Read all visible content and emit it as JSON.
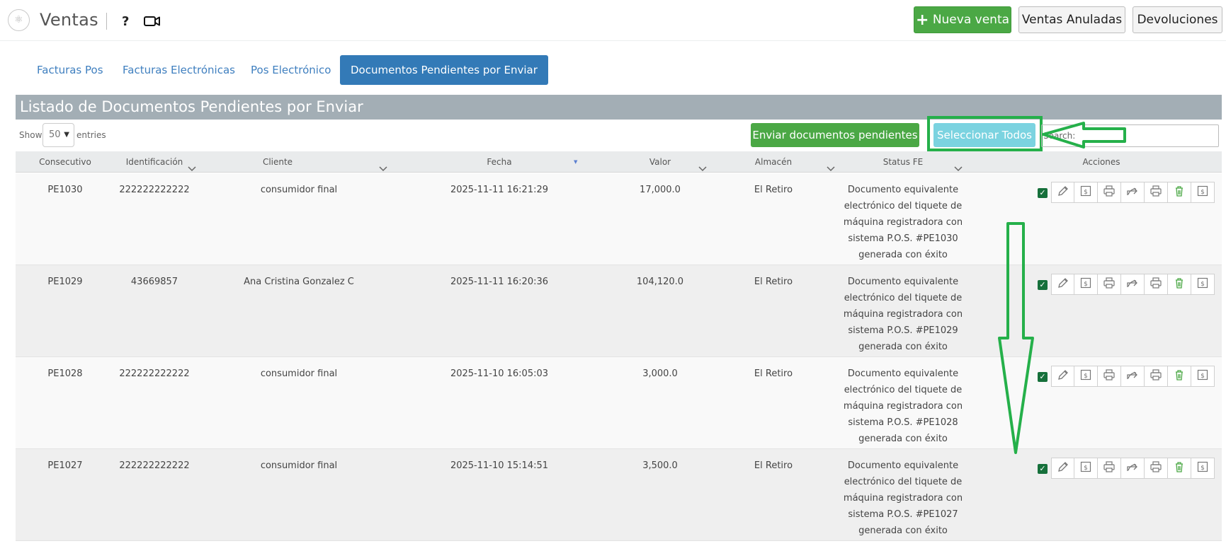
{
  "header": {
    "title": "Ventas",
    "help": "?",
    "buttons": {
      "new_sale": "Nueva venta",
      "voided": "Ventas Anuladas",
      "returns": "Devoluciones"
    }
  },
  "tabs": [
    {
      "label": "Facturas Pos"
    },
    {
      "label": "Facturas Electrónicas"
    },
    {
      "label": "Pos Electrónico"
    },
    {
      "label": "Documentos Pendientes por Enviar"
    }
  ],
  "panel": {
    "title": "Listado de Documentos Pendientes por Enviar",
    "show": "Show",
    "entries": "entries",
    "page_size": "50",
    "send_button": "Enviar documentos pendientes",
    "select_all_button": "Seleccionar Todos",
    "search_label": "Search:"
  },
  "table": {
    "columns": [
      "Consecutivo",
      "Identificación",
      "Cliente",
      "Fecha",
      "Valor",
      "Almacén",
      "Status FE",
      "Acciones"
    ],
    "rows": [
      {
        "consecutivo": "PE1030",
        "identificacion": "222222222222",
        "cliente": "consumidor final",
        "fecha": "2025-11-11 16:21:29",
        "valor": "17,000.0",
        "almacen": "El Retiro",
        "status": [
          "Documento equivalente",
          "electrónico del tiquete de",
          "máquina registradora con",
          "sistema P.O.S. #PE1030",
          "generada con éxito"
        ]
      },
      {
        "consecutivo": "PE1029",
        "identificacion": "43669857",
        "cliente": "Ana Cristina Gonzalez C",
        "fecha": "2025-11-11 16:20:36",
        "valor": "104,120.0",
        "almacen": "El Retiro",
        "status": [
          "Documento equivalente",
          "electrónico del tiquete de",
          "máquina registradora con",
          "sistema P.O.S. #PE1029",
          "generada con éxito"
        ]
      },
      {
        "consecutivo": "PE1028",
        "identificacion": "222222222222",
        "cliente": "consumidor final",
        "fecha": "2025-11-10 16:05:03",
        "valor": "3,000.0",
        "almacen": "El Retiro",
        "status": [
          "Documento equivalente",
          "electrónico del tiquete de",
          "máquina registradora con",
          "sistema P.O.S. #PE1028",
          "generada con éxito"
        ]
      },
      {
        "consecutivo": "PE1027",
        "identificacion": "222222222222",
        "cliente": "consumidor final",
        "fecha": "2025-11-10 15:14:51",
        "valor": "3,500.0",
        "almacen": "El Retiro",
        "status": [
          "Documento equivalente",
          "electrónico del tiquete de",
          "máquina registradora con",
          "sistema P.O.S. #PE1027",
          "generada con éxito"
        ]
      }
    ]
  },
  "action_icons": [
    "pencil-icon",
    "money-upload-icon",
    "print-icon",
    "share-icon",
    "print-icon",
    "trash-icon",
    "money-upload-icon"
  ],
  "colors": {
    "accent_green": "#4ba845",
    "tab_active": "#337ab7",
    "select_all": "#7bd3e0",
    "annotation": "#25b04a"
  }
}
